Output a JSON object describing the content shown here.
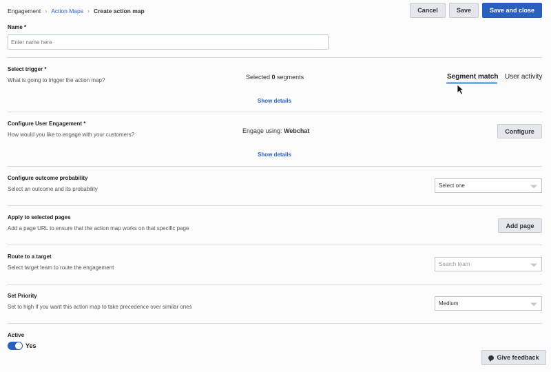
{
  "breadcrumb": {
    "items": [
      "Engagement",
      "Action Maps",
      "Create action map"
    ],
    "sep": "›"
  },
  "toolbar": {
    "cancel_label": "Cancel",
    "save_label": "Save",
    "save_close_label": "Save and close"
  },
  "name_section": {
    "label": "Name *",
    "placeholder": "Enter name here"
  },
  "trigger_section": {
    "label": "Select trigger *",
    "desc": "What is going to trigger the action map?",
    "selected_prefix": "Selected",
    "selected_count": "0",
    "selected_suffix": "segments",
    "tabs": [
      "Segment match",
      "User activity"
    ],
    "show_details": "Show details"
  },
  "engagement_section": {
    "label": "Configure User Engagement *",
    "desc": "How would you like to engage with your customers?",
    "engage_prefix": "Engage using:",
    "engage_value": "Webchat",
    "configure_label": "Configure",
    "show_details": "Show details"
  },
  "outcome_section": {
    "label": "Configure outcome probability",
    "desc": "Select an outcome and its probability",
    "select_value": "Select one"
  },
  "pages_section": {
    "label": "Apply to selected pages",
    "desc": "Add a page URL to ensure that the action map works on that specific page",
    "add_page_label": "Add page"
  },
  "route_section": {
    "label": "Route to a target",
    "desc": "Select target team to route the engagement",
    "select_placeholder": "Search team"
  },
  "priority_section": {
    "label": "Set Priority",
    "desc": "Set to high if you want this action map to take precedence over similar ones",
    "select_value": "Medium"
  },
  "active_section": {
    "label": "Active",
    "toggle_value": "Yes"
  },
  "feedback": {
    "label": "Give feedback"
  },
  "colors": {
    "primary": "#2a5fbf",
    "link": "#2a60c8",
    "tab_underline": "#7aaee6"
  }
}
